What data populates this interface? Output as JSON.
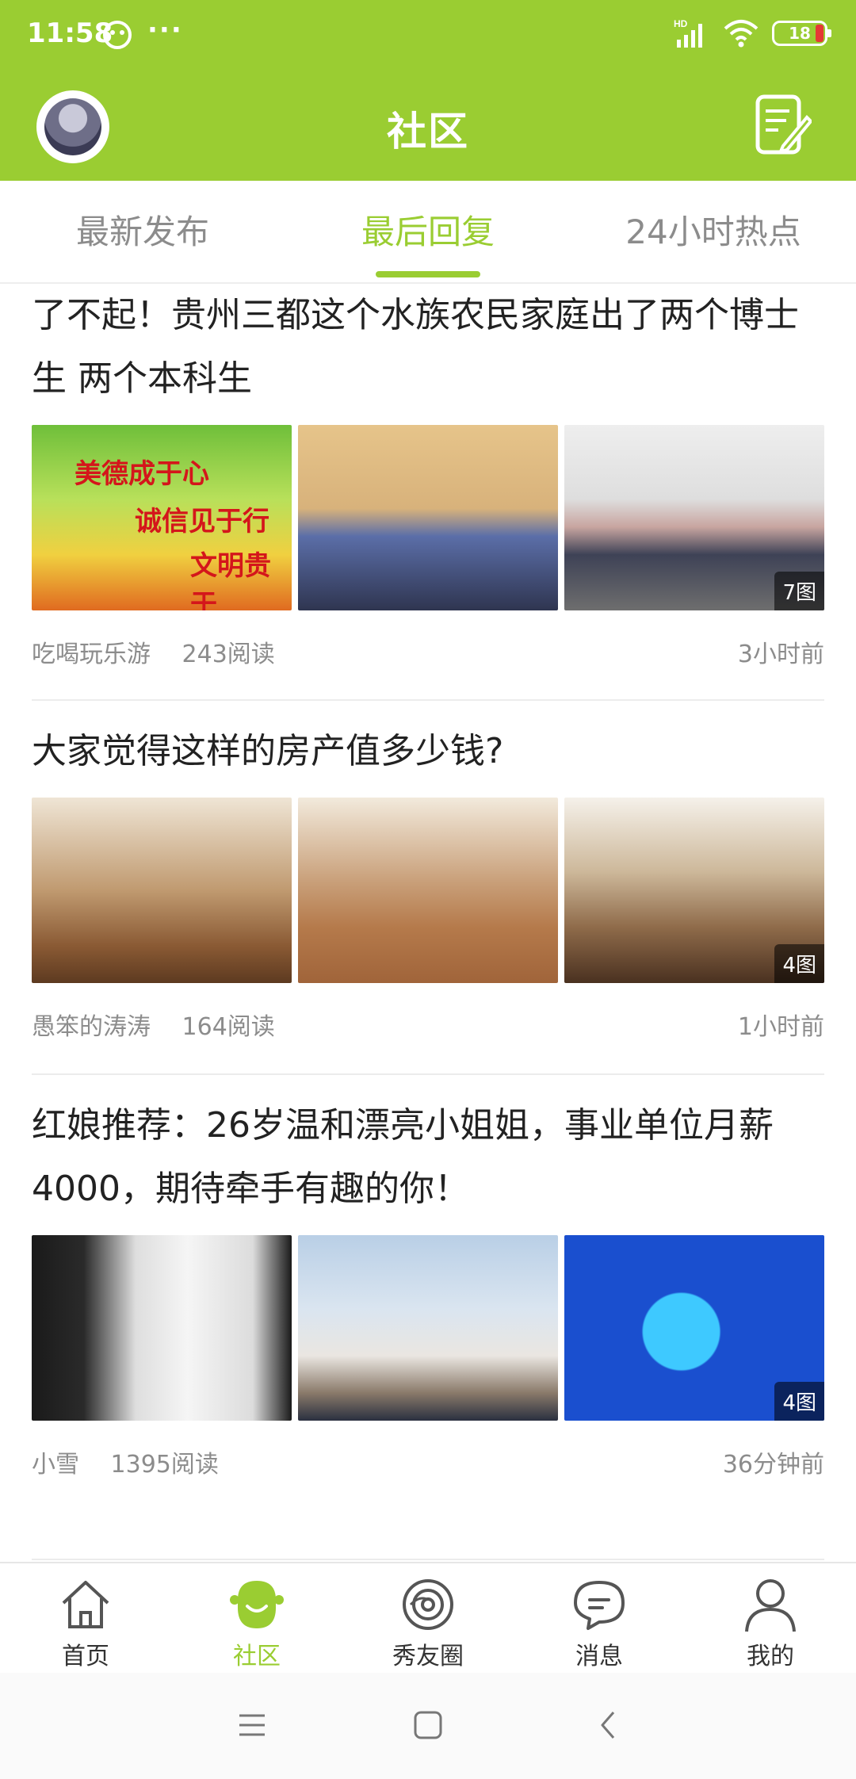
{
  "status_bar": {
    "time": "11:58",
    "battery": "18",
    "network": "HD"
  },
  "header": {
    "title": "社区"
  },
  "tabs": [
    {
      "label": "最新发布",
      "active": false
    },
    {
      "label": "最后回复",
      "active": true
    },
    {
      "label": "24小时热点",
      "active": false
    }
  ],
  "posts": [
    {
      "title": "了不起！贵州三都这个水族农民家庭出了两个博士生 两个本科生",
      "image_count": "7图",
      "image_text": [
        "美德成于心",
        "诚信见于行",
        "文明贵于"
      ],
      "author": "吃喝玩乐游",
      "reads": "243阅读",
      "time": "3小时前"
    },
    {
      "title": "大家觉得这样的房产值多少钱?",
      "image_count": "4图",
      "author": "愚笨的涛涛",
      "reads": "164阅读",
      "time": "1小时前"
    },
    {
      "title": "红娘推荐：26岁温和漂亮小姐姐，事业单位月薪4000，期待牵手有趣的你！",
      "image_count": "4图",
      "author": "小雪",
      "reads": "1395阅读",
      "time": "36分钟前"
    }
  ],
  "bottom_nav": [
    {
      "label": "首页",
      "icon": "home-icon",
      "active": false
    },
    {
      "label": "社区",
      "icon": "community-icon",
      "active": true
    },
    {
      "label": "秀友圈",
      "icon": "circle-icon",
      "active": false
    },
    {
      "label": "消息",
      "icon": "message-icon",
      "active": false
    },
    {
      "label": "我的",
      "icon": "profile-icon",
      "active": false
    }
  ],
  "colors": {
    "accent": "#9acd32",
    "muted_text": "#8c8c8c",
    "title_text": "#222222"
  }
}
